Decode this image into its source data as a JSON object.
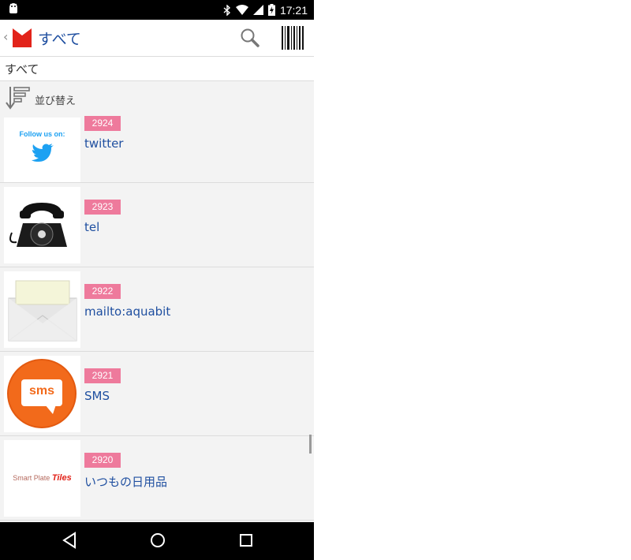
{
  "status_bar": {
    "time": "17:21"
  },
  "app_bar": {
    "title": "すべて"
  },
  "category": {
    "label": "すべて"
  },
  "sort": {
    "label": "並び替え"
  },
  "items": [
    {
      "id": "2924",
      "name": "twitter",
      "thumb_text": "Follow us on:",
      "thumb_icon": "twitter-bird-icon"
    },
    {
      "id": "2923",
      "name": "tel",
      "thumb_icon": "rotary-telephone-icon"
    },
    {
      "id": "2922",
      "name": "mailto:aquabit",
      "thumb_icon": "envelope-icon"
    },
    {
      "id": "2921",
      "name": "SMS",
      "thumb_text": "sms",
      "thumb_icon": "sms-bubble-icon"
    },
    {
      "id": "2920",
      "name": "いつもの日用品",
      "thumb_text_a": "Smart Plate ",
      "thumb_text_b": "Tiles"
    }
  ],
  "colors": {
    "accent": "#1f4fa0",
    "badge": "#ee7a9c",
    "logo": "#e2231a",
    "twitter": "#1da1f2",
    "sms": "#f26a1b"
  }
}
